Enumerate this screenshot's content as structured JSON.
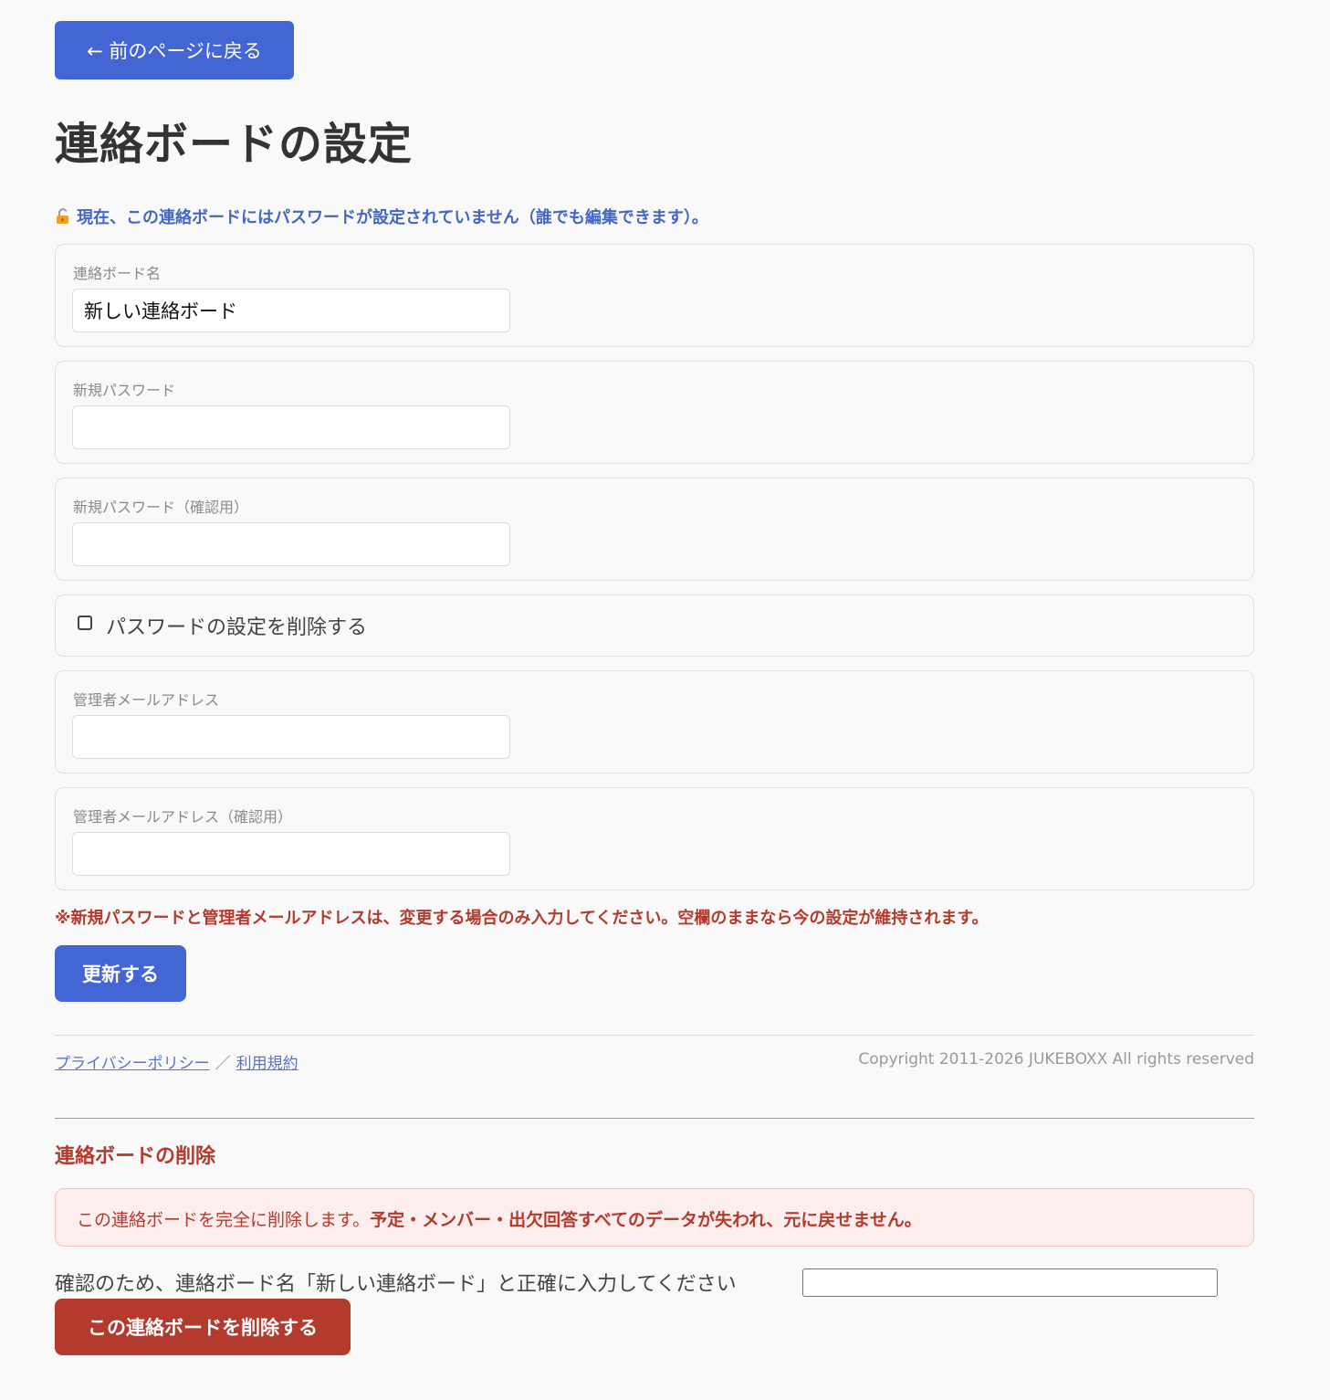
{
  "nav": {
    "back_label": "← 前のページに戻る"
  },
  "page": {
    "title": "連絡ボードの設定"
  },
  "notice": {
    "icon": "unlocked-padlock-icon",
    "text": "現在、この連絡ボードにはパスワードが設定されていません（誰でも編集できます）。"
  },
  "form": {
    "board_name": {
      "label": "連絡ボード名",
      "value": "新しい連絡ボード"
    },
    "new_password": {
      "label": "新規パスワード",
      "value": ""
    },
    "new_password_confirm": {
      "label": "新規パスワード（確認用）",
      "value": ""
    },
    "remove_password": {
      "label": "パスワードの設定を削除する",
      "checked": false
    },
    "admin_email": {
      "label": "管理者メールアドレス",
      "value": ""
    },
    "admin_email_confirm": {
      "label": "管理者メールアドレス（確認用）",
      "value": ""
    },
    "note": "※新規パスワードと管理者メールアドレスは、変更する場合のみ入力してください。空欄のままなら今の設定が維持されます。",
    "submit_label": "更新する"
  },
  "footer": {
    "privacy_link": "プライバシーポリシー",
    "separator": "／",
    "terms_link": "利用規約",
    "copyright": "Copyright 2011-2026 JUKEBOXX All rights reserved"
  },
  "delete_section": {
    "title": "連絡ボードの削除",
    "warning_plain": "この連絡ボードを完全に削除します。",
    "warning_bold": "予定・メンバー・出欠回答すべてのデータが失われ、元に戻せません。",
    "confirm_label": "確認のため、連絡ボード名「新しい連絡ボード」と正確に入力してください",
    "confirm_value": "",
    "delete_label": "この連絡ボードを削除する"
  },
  "colors": {
    "primary": "#4466d4",
    "danger": "#b53a2e",
    "danger_bg": "#fdeeee",
    "page_bg": "#f9f9f9"
  }
}
